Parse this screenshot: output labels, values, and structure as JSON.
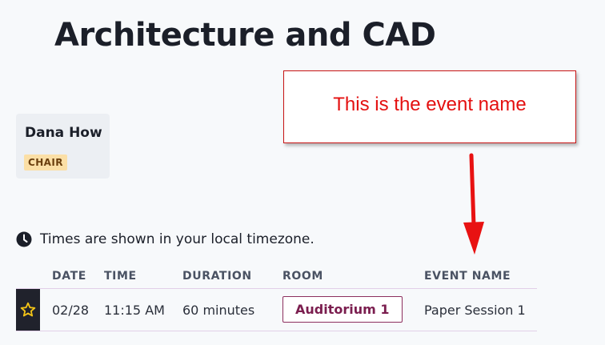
{
  "page": {
    "title": "Architecture and CAD"
  },
  "person": {
    "name": "Dana How",
    "role": "CHAIR"
  },
  "annotation": {
    "callout_text": "This is the event name",
    "color": "#e41010"
  },
  "timezone_note": {
    "icon": "clock-icon",
    "text": "Times are shown in your local timezone."
  },
  "schedule": {
    "columns": [
      "DATE",
      "TIME",
      "DURATION",
      "ROOM",
      "EVENT NAME"
    ],
    "rows": [
      {
        "favorite_icon": "star-outline-icon",
        "date": "02/28",
        "time": "11:15 AM",
        "duration": "60 minutes",
        "room": "Auditorium 1",
        "event_name": "Paper Session 1"
      }
    ]
  },
  "colors": {
    "accent": "#7b1e4f",
    "badge_bg": "#fbdfa6",
    "star": "#f2c317",
    "row_border": "#e2cfe8"
  }
}
